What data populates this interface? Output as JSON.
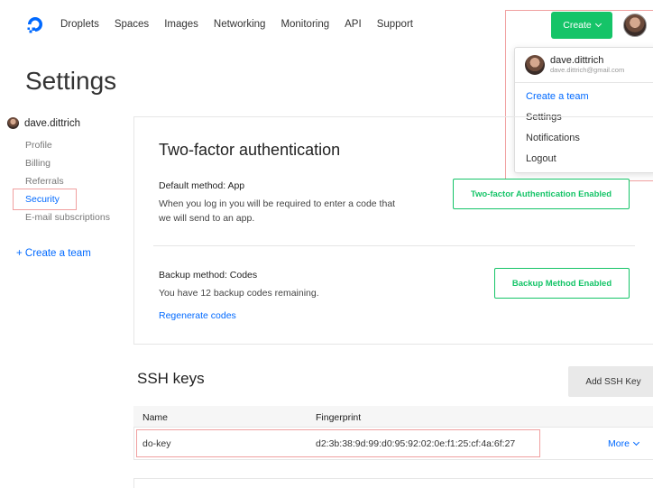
{
  "nav": {
    "items": [
      "Droplets",
      "Spaces",
      "Images",
      "Networking",
      "Monitoring",
      "API",
      "Support"
    ],
    "create_label": "Create"
  },
  "dropdown": {
    "user_name": "dave.dittrich",
    "user_email": "dave.dittrich@gmail.com",
    "items": [
      "Create a team",
      "Settings",
      "Notifications",
      "Logout"
    ]
  },
  "settings": {
    "title": "Settings",
    "user_name": "dave.dittrich",
    "links": [
      "Profile",
      "Billing",
      "Referrals",
      "Security",
      "E-mail subscriptions"
    ],
    "active_link": "Security",
    "create_team": "+ Create a team"
  },
  "two_factor": {
    "title": "Two-factor authentication",
    "default_label": "Default method: App",
    "default_desc_1": "When you log in you will be required to enter a code that",
    "default_desc_2": "we will send to an app.",
    "enabled_button": "Two-factor Authentication Enabled",
    "backup_label": "Backup method: Codes",
    "backup_desc": "You have 12 backup codes remaining.",
    "regenerate_link": "Regenerate codes",
    "backup_button": "Backup Method Enabled"
  },
  "ssh": {
    "title": "SSH keys",
    "add_button": "Add SSH Key",
    "columns": [
      "Name",
      "Fingerprint"
    ],
    "rows": [
      {
        "name": "do-key",
        "fingerprint": "d2:3b:38:9d:99:d0:95:92:02:0e:f1:25:cf:4a:6f:27",
        "action": "More"
      }
    ]
  },
  "colors": {
    "accent": "#0069ff",
    "success": "#15c468"
  }
}
